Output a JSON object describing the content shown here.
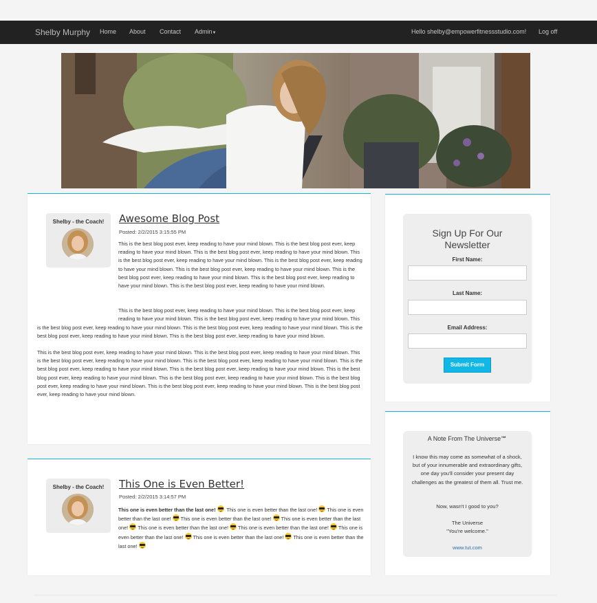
{
  "navbar": {
    "brand": "Shelby Murphy",
    "items": [
      "Home",
      "About",
      "Contact",
      "Admin"
    ],
    "greeting": "Hello shelby@empowerfitnessstudio.com!",
    "logoff": "Log off"
  },
  "posts": [
    {
      "author": "Shelby - the Coach!",
      "title": "Awesome Blog Post",
      "posted": "Posted: 2/2/2015 3:15:55 PM",
      "paragraphs": [
        "This is the best blog post ever, keep reading to have your mind blown. This is the best blog post ever, keep reading to have your mind blown. This is the best blog post ever, keep reading to have your mind blown. This is the best blog post ever, keep reading to have your mind blown. This is the best blog post ever, keep reading to have your mind blown. This is the best blog post ever, keep reading to have your mind blown. This is the best blog post ever, keep reading to have your mind blown. This is the best blog post ever, keep reading to have your mind blown. This is the best blog post ever, keep reading to have your mind blown.",
        "This is the best blog post ever, keep reading to have your mind blown. This is the best blog post ever, keep reading to have your mind blown. This is the best blog post ever, keep reading to have your mind blown. This is the best blog post ever, keep reading to have your mind blown. This is the best blog post ever, keep reading to have your mind blown. This is the best blog post ever, keep reading to have your mind blown. This is the best blog post ever, keep reading to have your mind blown.",
        "This is the best blog post ever, keep reading to have your mind blown. This is the best blog post ever, keep reading to have your mind blown. This is the best blog post ever, keep reading to have your mind blown. This is the best blog post ever, keep reading to have your mind blown. This is the best blog post ever, keep reading to have your mind blown. This is the best blog post ever, keep reading to have your mind blown. This is the best blog post ever, keep reading to have your mind blown. This is the best blog post ever, keep reading to have your mind blown. This is the best blog post ever, keep reading to have your mind blown. This is the best blog post ever, keep reading to have your mind blown. This is the best blog post ever, keep reading to have your mind blown."
      ]
    },
    {
      "author": "Shelby - the Coach!",
      "title": "This One is Even Better!",
      "posted": "Posted: 2/2/2015 3:14:57 PM",
      "lead": "This one is even better than the last one!",
      "repeat": "This one is even better than the last one!",
      "repeat_count": 9,
      "emoji": "sunglasses-face"
    }
  ],
  "newsletter": {
    "title": "Sign Up For Our Newsletter",
    "first_name_label": "First Name:",
    "last_name_label": "Last Name:",
    "email_label": "Email Address:",
    "first_name_value": "",
    "last_name_value": "",
    "email_value": "",
    "submit_label": "Submit Form"
  },
  "universe_note": {
    "title": "A Note From The Universe℠",
    "body": "I know this may come as somewhat of a shock, but of your innumerable and extraordinary gifts, one day you'll consider your present day challenges as the greatest of them all. Trust me.",
    "question": "Now, wasn't I good to you?",
    "signature": "The Universe",
    "closing": "\"You're welcome.\"",
    "link": "www.tut.com"
  },
  "colors": {
    "accent": "#17b6d8",
    "button": "#11b7e6",
    "navbar": "#222222",
    "link": "#2a6fb0"
  }
}
